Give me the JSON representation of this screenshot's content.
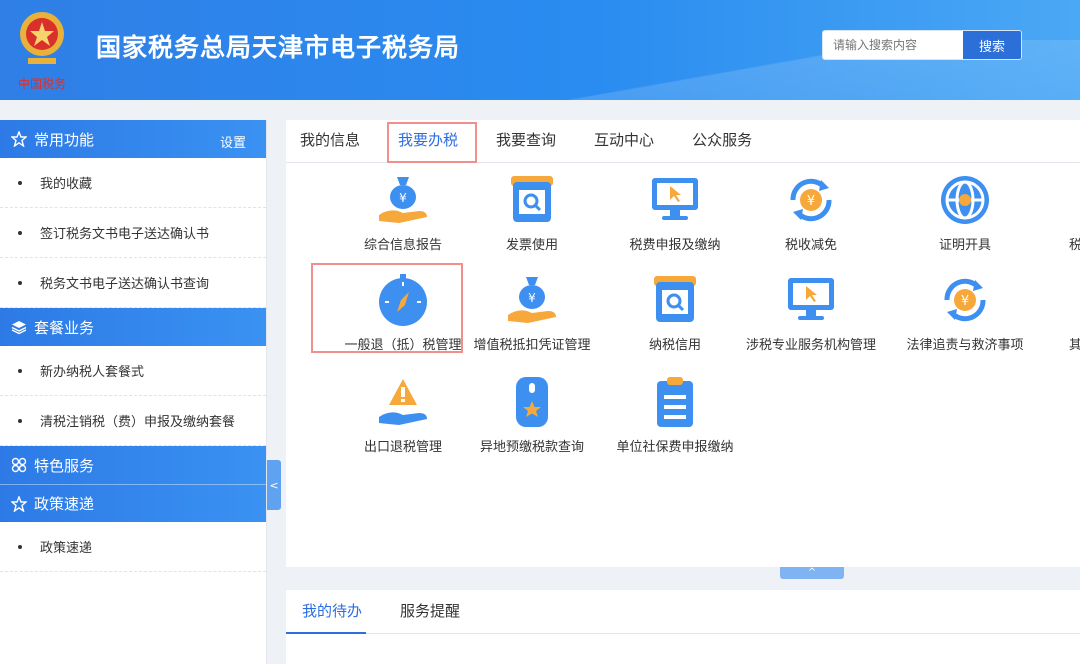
{
  "header": {
    "title": "国家税务总局天津市电子税务局",
    "emblem_caption": "中国税务",
    "search_placeholder": "请输入搜索内容",
    "search_button": "搜索"
  },
  "sidebar": {
    "sections": [
      {
        "title": "常用功能",
        "action": "设置",
        "items": [
          "我的收藏",
          "签订税务文书电子送达确认书",
          "税务文书电子送达确认书查询"
        ]
      },
      {
        "title": "套餐业务",
        "items": [
          "新办纳税人套餐式",
          "清税注销税（费）申报及缴纳套餐"
        ]
      },
      {
        "title": "特色服务",
        "items": []
      },
      {
        "title": "政策速递",
        "items": [
          "政策速递"
        ]
      }
    ],
    "collapse": "<"
  },
  "tabs": [
    "我的信息",
    "我要办税",
    "我要查询",
    "互动中心",
    "公众服务"
  ],
  "active_tab": "我要办税",
  "services": [
    {
      "label": "综合信息报告",
      "icon": "money-bag-hand-icon"
    },
    {
      "label": "发票使用",
      "icon": "invoice-search-icon"
    },
    {
      "label": "税费申报及缴纳",
      "icon": "monitor-cursor-icon"
    },
    {
      "label": "税收减免",
      "icon": "yuan-refresh-icon"
    },
    {
      "label": "证明开具",
      "icon": "globe-certificate-icon"
    },
    {
      "label": "税",
      "icon": "cut-off-icon"
    },
    {
      "label": "一般退（抵）税管理",
      "icon": "compass-icon"
    },
    {
      "label": "增值税抵扣凭证管理",
      "icon": "money-bag-hand-icon"
    },
    {
      "label": "纳税信用",
      "icon": "invoice-search-icon"
    },
    {
      "label": "涉税专业服务机构管理",
      "icon": "monitor-cursor-icon"
    },
    {
      "label": "法律追责与救济事项",
      "icon": "yuan-refresh-icon"
    },
    {
      "label": "其",
      "icon": "cut-off-icon"
    },
    {
      "label": "出口退税管理",
      "icon": "warning-hand-icon"
    },
    {
      "label": "异地预缴税款查询",
      "icon": "star-card-icon"
    },
    {
      "label": "单位社保费申报缴纳",
      "icon": "clipboard-list-icon"
    }
  ],
  "fold_label": "^",
  "todo_tabs": [
    "我的待办",
    "服务提醒"
  ],
  "colors": {
    "primary": "#2d6ee0",
    "icon_blue": "#3d8ff0",
    "icon_orange": "#f7a83a",
    "highlight": "#f08f8b"
  }
}
